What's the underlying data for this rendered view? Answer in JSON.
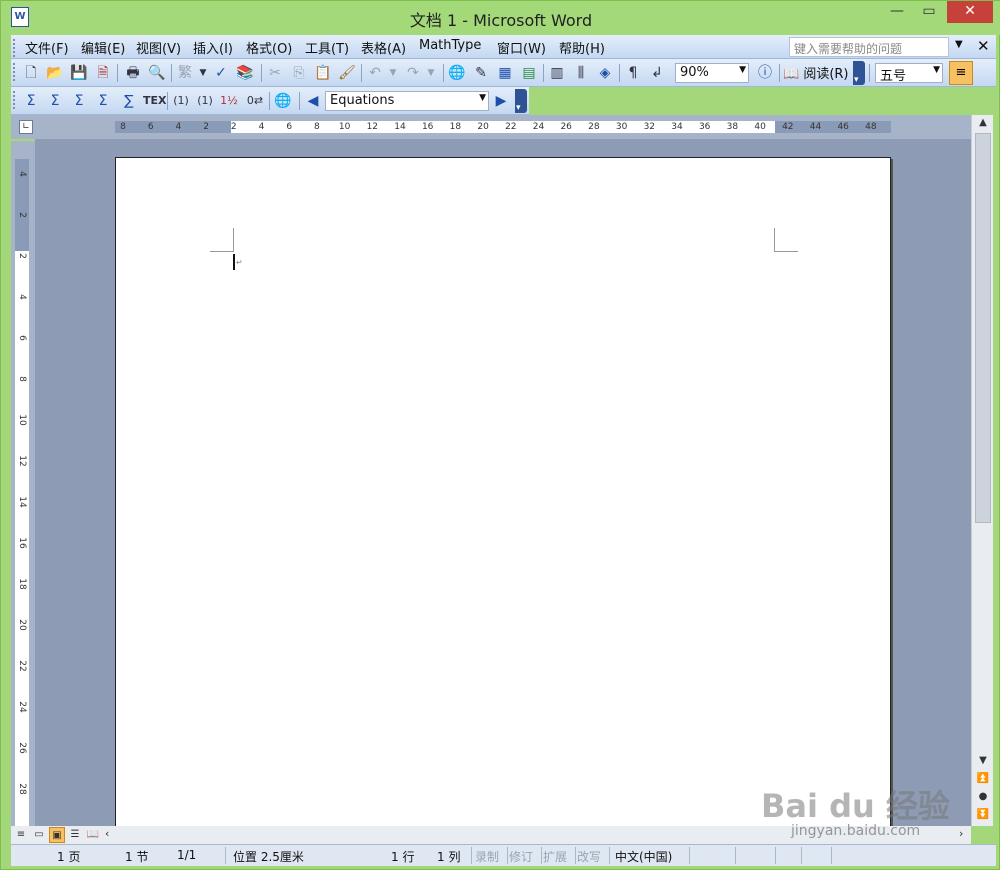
{
  "window": {
    "title": "文档 1 - Microsoft Word",
    "app_icon": "W"
  },
  "menubar": {
    "items": [
      "文件(F)",
      "编辑(E)",
      "视图(V)",
      "插入(I)",
      "格式(O)",
      "工具(T)",
      "表格(A)",
      "MathType",
      "窗口(W)",
      "帮助(H)"
    ],
    "help_placeholder": "键入需要帮助的问题"
  },
  "toolbar": {
    "zoom": "90%",
    "read_label": "阅读(R)",
    "font_size": "五号"
  },
  "mathtype_toolbar": {
    "equations_label": "Equations"
  },
  "hruler": {
    "ticks": [
      "8",
      "6",
      "4",
      "2",
      "2",
      "4",
      "6",
      "8",
      "10",
      "12",
      "14",
      "16",
      "18",
      "20",
      "22",
      "24",
      "26",
      "28",
      "30",
      "32",
      "34",
      "36",
      "38",
      "40",
      "42",
      "44",
      "46",
      "48"
    ]
  },
  "vruler": {
    "ticks": [
      "4",
      "2",
      "2",
      "4",
      "6",
      "8",
      "10",
      "12",
      "14",
      "16",
      "18",
      "20",
      "22",
      "24",
      "26",
      "28"
    ]
  },
  "statusbar": {
    "page": "1 页",
    "section": "1 节",
    "page_of": "1/1",
    "position": "位置 2.5厘米",
    "line": "1 行",
    "column": "1 列",
    "rec": "录制",
    "trk": "修订",
    "ext": "扩展",
    "ovr": "改写",
    "language": "中文(中国)"
  },
  "watermark": {
    "brand": "Bai du 经验",
    "url": "jingyan.baidu.com"
  }
}
